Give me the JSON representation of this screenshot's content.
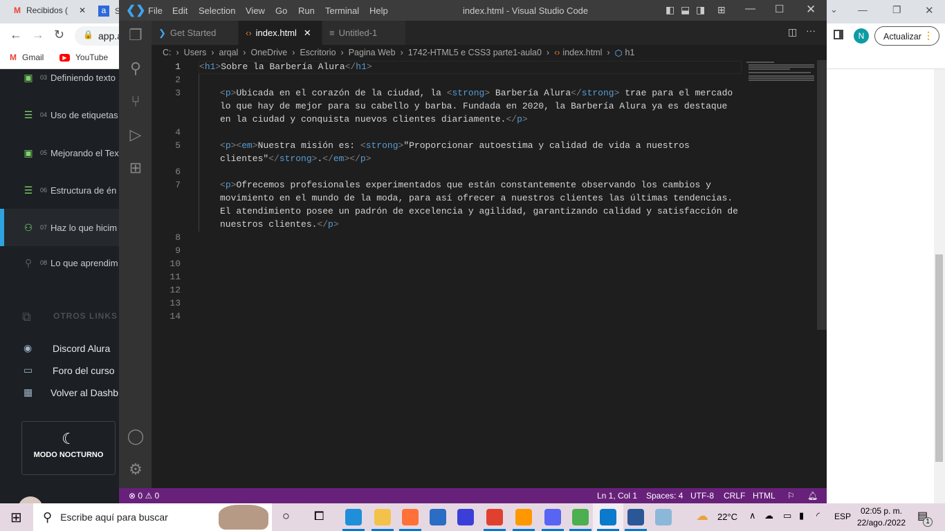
{
  "browser": {
    "tabs": [
      {
        "label": "Recibidos (",
        "icon": "gmail-icon"
      },
      {
        "label": "S",
        "icon": "alura-icon"
      }
    ],
    "address": "app.a",
    "bookmarks": [
      {
        "label": "Gmail",
        "icon": "gmail-icon"
      },
      {
        "label": "YouTube",
        "icon": "youtube-icon"
      }
    ],
    "profile_initial": "N",
    "update_label": "Actualizar",
    "profile_color": "#0f9ba3"
  },
  "course": {
    "lessons": [
      {
        "num": "03",
        "label": "Definiendo texto",
        "icon": "video-icon"
      },
      {
        "num": "04",
        "label": "Uso de etiquetas",
        "icon": "list-icon"
      },
      {
        "num": "05",
        "label": "Mejorando el Tex",
        "icon": "video-icon"
      },
      {
        "num": "06",
        "label": "Estructura de én",
        "icon": "list-icon"
      },
      {
        "num": "07",
        "label": "Haz lo que hicim",
        "icon": "people-icon",
        "active": true
      },
      {
        "num": "08",
        "label": "Lo que aprendim",
        "icon": "person-edit-icon"
      }
    ],
    "other_links_title": "OTROS LINKS",
    "links": [
      {
        "label": "Discord Alura",
        "icon": "discord-icon"
      },
      {
        "label": "Foro del curso",
        "icon": "forum-icon"
      },
      {
        "label": "Volver al Dashb",
        "icon": "dashboard-icon"
      }
    ],
    "night_mode": "MODO NOCTURNO",
    "accent": "#7ed36c"
  },
  "vscode": {
    "title": "index.html - Visual Studio Code",
    "menu": [
      "File",
      "Edit",
      "Selection",
      "View",
      "Go",
      "Run",
      "Terminal",
      "Help"
    ],
    "tabs": [
      {
        "label": "Get Started"
      },
      {
        "label": "index.html",
        "active": true
      },
      {
        "label": "Untitled-1"
      }
    ],
    "breadcrumb": [
      "C:",
      "Users",
      "arqal",
      "OneDrive",
      "Escritorio",
      "Pagina Web",
      "1742-HTML5 e CSS3 parte1-aula0",
      "index.html",
      "h1"
    ],
    "code": [
      {
        "num": "1",
        "rows": [
          [
            [
              "br",
              "<"
            ],
            [
              "tag",
              "h1"
            ],
            [
              "br",
              ">"
            ],
            [
              "txt",
              "Sobre la Barbería Alura"
            ],
            [
              "br",
              "</"
            ],
            [
              "tag",
              "h1"
            ],
            [
              "br",
              ">"
            ]
          ]
        ],
        "indent": 0
      },
      {
        "num": "2",
        "rows": [
          []
        ],
        "indent": 0
      },
      {
        "num": "3",
        "indent": 1,
        "rows": [
          [
            [
              "br",
              "<"
            ],
            [
              "tag",
              "p"
            ],
            [
              "br",
              ">"
            ],
            [
              "txt",
              "Ubicada en el corazón de la ciudad, la "
            ],
            [
              "br",
              "<"
            ],
            [
              "tag",
              "strong"
            ],
            [
              "br",
              ">"
            ],
            [
              "txt",
              " Barbería Alura"
            ],
            [
              "br",
              "</"
            ],
            [
              "tag",
              "strong"
            ],
            [
              "br",
              ">"
            ],
            [
              "txt",
              " trae para el mercado"
            ]
          ],
          [
            [
              "txt",
              "lo que hay de mejor para su cabello y barba. Fundada en 2020, la Barbería Alura ya es destaque"
            ]
          ],
          [
            [
              "txt",
              "en la ciudad y conquista nuevos clientes diariamente."
            ],
            [
              "br",
              "</"
            ],
            [
              "tag",
              "p"
            ],
            [
              "br",
              ">"
            ]
          ]
        ]
      },
      {
        "num": "4",
        "rows": [
          []
        ],
        "indent": 0
      },
      {
        "num": "5",
        "indent": 1,
        "rows": [
          [
            [
              "br",
              "<"
            ],
            [
              "tag",
              "p"
            ],
            [
              "br",
              "><"
            ],
            [
              "tag",
              "em"
            ],
            [
              "br",
              ">"
            ],
            [
              "txt",
              "Nuestra misión es: "
            ],
            [
              "br",
              "<"
            ],
            [
              "tag",
              "strong"
            ],
            [
              "br",
              ">"
            ],
            [
              "txt",
              "\"Proporcionar autoestima y calidad de vida a nuestros"
            ]
          ],
          [
            [
              "txt",
              "clientes\""
            ],
            [
              "br",
              "</"
            ],
            [
              "tag",
              "strong"
            ],
            [
              "br",
              ">"
            ],
            [
              "txt",
              "."
            ],
            [
              "br",
              "</"
            ],
            [
              "tag",
              "em"
            ],
            [
              "br",
              "></"
            ],
            [
              "tag",
              "p"
            ],
            [
              "br",
              ">"
            ]
          ]
        ]
      },
      {
        "num": "6",
        "rows": [
          []
        ],
        "indent": 0
      },
      {
        "num": "7",
        "indent": 1,
        "rows": [
          [
            [
              "br",
              "<"
            ],
            [
              "tag",
              "p"
            ],
            [
              "br",
              ">"
            ],
            [
              "txt",
              "Ofrecemos profesionales experimentados que están constantemente observando los cambios y"
            ]
          ],
          [
            [
              "txt",
              "movimiento en el mundo de la moda, para así ofrecer a nuestros clientes las últimas tendencias."
            ]
          ],
          [
            [
              "txt",
              "El atendimiento posee un padrón de excelencia y agilidad, garantizando calidad y satisfacción de"
            ]
          ],
          [
            [
              "txt",
              "nuestros clientes."
            ],
            [
              "br",
              "</"
            ],
            [
              "tag",
              "p"
            ],
            [
              "br",
              ">"
            ]
          ]
        ]
      },
      {
        "num": "8",
        "rows": [
          []
        ],
        "indent": 0
      },
      {
        "num": "9",
        "rows": [
          []
        ],
        "indent": 0
      },
      {
        "num": "10",
        "rows": [
          []
        ],
        "indent": 0
      },
      {
        "num": "11",
        "rows": [
          []
        ],
        "indent": 0
      },
      {
        "num": "12",
        "rows": [
          []
        ],
        "indent": 0
      },
      {
        "num": "13",
        "rows": [
          []
        ],
        "indent": 0
      },
      {
        "num": "14",
        "rows": [
          []
        ],
        "indent": 0
      }
    ],
    "status": {
      "errors": "0",
      "warnings": "0",
      "position": "Ln 1, Col 1",
      "spaces": "Spaces: 4",
      "encoding": "UTF-8",
      "eol": "CRLF",
      "language": "HTML"
    },
    "status_color": "#68217a"
  },
  "taskbar": {
    "search_placeholder": "Escribe aquí para buscar",
    "weather": "22°C",
    "language": "ESP",
    "time": "02:05 p. m.",
    "date": "22/ago./2022",
    "notifications": "1",
    "apps": [
      "edge-icon",
      "file-explorer-icon",
      "firefox-icon",
      "store-icon",
      "app-icon",
      "office-icon",
      "sublime-icon",
      "discord-icon",
      "chrome-icon",
      "vscode-icon",
      "word-icon",
      "notepad-icon"
    ]
  }
}
